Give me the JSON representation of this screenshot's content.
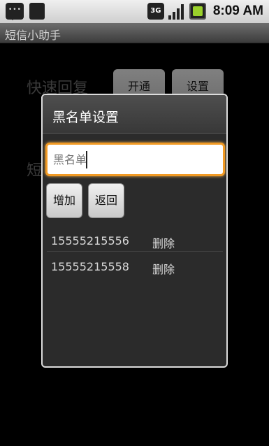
{
  "status_bar": {
    "network": "3G",
    "time": "8:09 AM",
    "icons": [
      "message-icon",
      "sim-card-icon",
      "3g-icon",
      "signal-icon",
      "battery-icon"
    ]
  },
  "app": {
    "title": "短信小助手"
  },
  "background": {
    "quick_reply_label": "快速回复",
    "open_button": "开通",
    "settings_button": "设置",
    "partial_label": "短"
  },
  "dialog": {
    "title": "黑名单设置",
    "input": {
      "value": "",
      "placeholder": "黑名单"
    },
    "add_button": "增加",
    "back_button": "返回",
    "entries": [
      {
        "number": "15555215556",
        "action": "删除"
      },
      {
        "number": "15555215558",
        "action": "删除"
      }
    ]
  },
  "colors": {
    "focus": "#f19a24",
    "dialog_bg": "#2b2b2b"
  }
}
